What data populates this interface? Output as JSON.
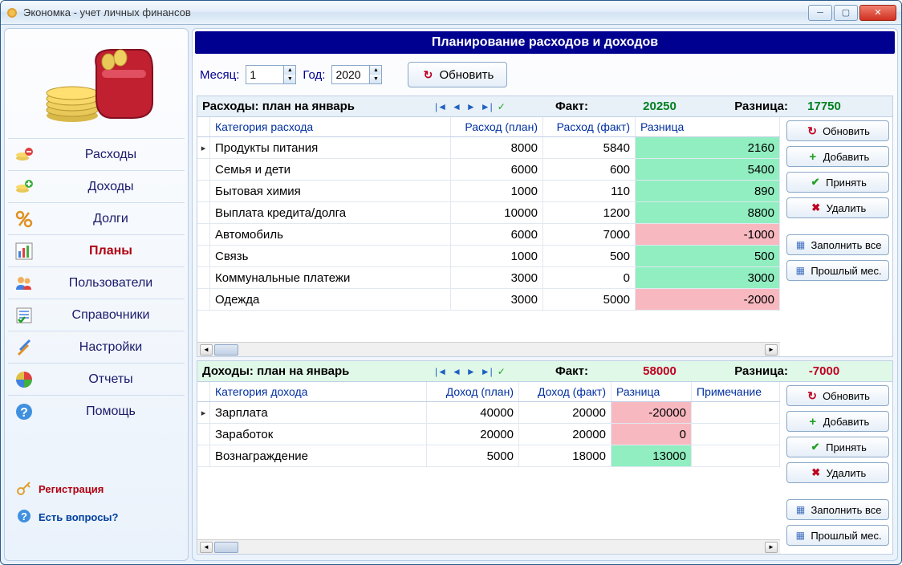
{
  "window": {
    "title": "Экономка - учет личных финансов"
  },
  "sidebar": {
    "items": [
      {
        "label": "Расходы"
      },
      {
        "label": "Доходы"
      },
      {
        "label": "Долги"
      },
      {
        "label": "Планы"
      },
      {
        "label": "Пользователи"
      },
      {
        "label": "Справочники"
      },
      {
        "label": "Настройки"
      },
      {
        "label": "Отчеты"
      },
      {
        "label": "Помощь"
      }
    ],
    "registration": "Регистрация",
    "questions": "Есть вопросы?"
  },
  "header": "Планирование расходов и доходов",
  "controls": {
    "month_label": "Месяц:",
    "month_value": "1",
    "year_label": "Год:",
    "year_value": "2020",
    "refresh": "Обновить"
  },
  "expenses": {
    "title": "Расходы: план на январь",
    "fact_label": "Факт:",
    "fact_value": "20250",
    "diff_label": "Разница:",
    "diff_value": "17750",
    "columns": {
      "cat": "Категория расхода",
      "plan": "Расход (план)",
      "fact": "Расход (факт)",
      "diff": "Разница"
    },
    "rows": [
      {
        "cat": "Продукты питания",
        "plan": "8000",
        "fact": "5840",
        "diff": "2160",
        "sign": "pos"
      },
      {
        "cat": "Семья и дети",
        "plan": "6000",
        "fact": "600",
        "diff": "5400",
        "sign": "pos"
      },
      {
        "cat": "Бытовая химия",
        "plan": "1000",
        "fact": "110",
        "diff": "890",
        "sign": "pos"
      },
      {
        "cat": "Выплата кредита/долга",
        "plan": "10000",
        "fact": "1200",
        "diff": "8800",
        "sign": "pos"
      },
      {
        "cat": "Автомобиль",
        "plan": "6000",
        "fact": "7000",
        "diff": "-1000",
        "sign": "neg"
      },
      {
        "cat": "Связь",
        "plan": "1000",
        "fact": "500",
        "diff": "500",
        "sign": "pos"
      },
      {
        "cat": "Коммунальные платежи",
        "plan": "3000",
        "fact": "0",
        "diff": "3000",
        "sign": "pos"
      },
      {
        "cat": "Одежда",
        "plan": "3000",
        "fact": "5000",
        "diff": "-2000",
        "sign": "neg"
      }
    ]
  },
  "incomes": {
    "title": "Доходы: план на январь",
    "fact_label": "Факт:",
    "fact_value": "58000",
    "diff_label": "Разница:",
    "diff_value": "-7000",
    "columns": {
      "cat": "Категория дохода",
      "plan": "Доход (план)",
      "fact": "Доход (факт)",
      "diff": "Разница",
      "note": "Примечание"
    },
    "rows": [
      {
        "cat": "Зарплата",
        "plan": "40000",
        "fact": "20000",
        "diff": "-20000",
        "sign": "neg"
      },
      {
        "cat": "Заработок",
        "plan": "20000",
        "fact": "20000",
        "diff": "0",
        "sign": "zero"
      },
      {
        "cat": "Вознаграждение",
        "plan": "5000",
        "fact": "18000",
        "diff": "13000",
        "sign": "pos"
      }
    ]
  },
  "sidebuttons": {
    "refresh": "Обновить",
    "add": "Добавить",
    "accept": "Принять",
    "delete": "Удалить",
    "fill_all": "Заполнить все",
    "prev_month": "Прошлый мес."
  }
}
